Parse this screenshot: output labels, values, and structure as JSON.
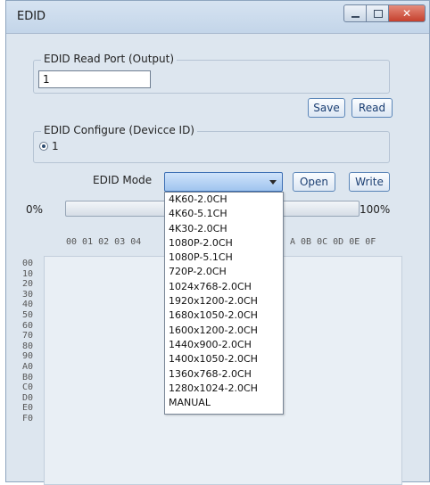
{
  "window": {
    "title": "EDID",
    "close_glyph": "✕"
  },
  "read_port": {
    "legend": "EDID Read Port (Output)",
    "value": "1"
  },
  "buttons": {
    "save": "Save",
    "read": "Read",
    "open": "Open",
    "write": "Write"
  },
  "configure": {
    "legend": "EDID Configure (Devicce ID)",
    "option": "1"
  },
  "mode": {
    "label": "EDID Mode",
    "selected": ""
  },
  "progress": {
    "start": "0%",
    "end": "100%",
    "value": 0
  },
  "hex": {
    "columns_left": "00 01 02 03 04",
    "columns_right": "A 0B 0C 0D 0E 0F",
    "rows": [
      "00",
      "10",
      "20",
      "30",
      "40",
      "50",
      "60",
      "70",
      "80",
      "90",
      "A0",
      "B0",
      "C0",
      "D0",
      "E0",
      "F0"
    ]
  },
  "dropdown_options": [
    "4K60-2.0CH",
    "4K60-5.1CH",
    "4K30-2.0CH",
    "1080P-2.0CH",
    "1080P-5.1CH",
    "720P-2.0CH",
    "1024x768-2.0CH",
    "1920x1200-2.0CH",
    "1680x1050-2.0CH",
    "1600x1200-2.0CH",
    "1440x900-2.0CH",
    "1400x1050-2.0CH",
    "1360x768-2.0CH",
    "1280x1024-2.0CH",
    "MANUAL"
  ]
}
